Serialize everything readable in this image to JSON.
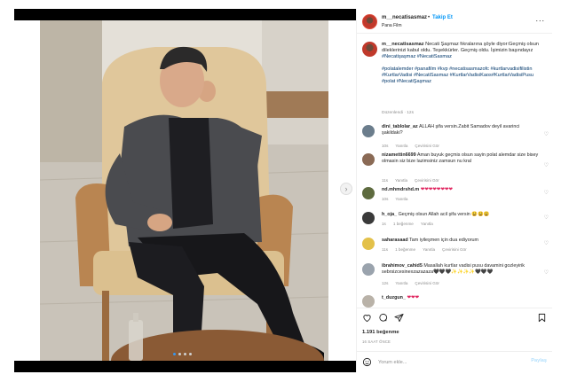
{
  "header": {
    "username": "m__necatisasmaz",
    "separator": "•",
    "follow_label": "Takip Et",
    "subtitle": "Pana Film",
    "more_label": "..."
  },
  "caption": {
    "username": "m__necatisasmaz",
    "text": "Necati Şaşmaz fıkralarına şöyle diyor:Geçmiş olsun dileklerinizi kabul oldu. Teşekkürler. Geçmiş oldu. İşimizin başındayız",
    "hashtags_1": "#Necatişaşmaz #NecatiSasmaz",
    "hashtags_2": "#polatalemder #panafilm #kvp #necatisasmazofc #kurtlarvadisifilistin #KurtlarVadisi #NecatiSasmaz #KurtlarVadisiKaos#KurtlarVadisiPusu #polat #NecatiŞaşmaz",
    "meta": "Düzenlendi · 12s"
  },
  "comments": [
    {
      "username": "dini_tablolar_az",
      "text": "ALLAH şifa versin.Zabit Samadov deyil avarinci şakildaki?",
      "age": "10s",
      "likes": "",
      "reply": "Yanıtla",
      "translate": "Çevirisini Gör"
    },
    {
      "username": "nizamettin6699",
      "text": "Aman buyuk geçmis olsun sayin polat alemdar size bisey olmasin siz bize lazimsiniz zamsun nu kral",
      "age": "11s",
      "likes": "",
      "reply": "Yanıtla",
      "translate": "Çevirisini Gör"
    },
    {
      "username": "nd.mhmdrshd.m",
      "text": "❤❤❤❤❤❤❤❤",
      "age": "10s",
      "likes": "",
      "reply": "Yanıtla",
      "translate": ""
    },
    {
      "username": "h_oja_",
      "text": "Geçmiş olsun Allah acil şifa versin 😩😩😩",
      "age": "1s",
      "likes": "1 beğenme",
      "reply": "Yanıtla",
      "translate": ""
    },
    {
      "username": "saharasaad",
      "text": "Tam iyileşmen için dua ediyorum",
      "age": "11s",
      "likes": "1 beğenme",
      "reply": "Yanıtla",
      "translate": "Çevirisini Gör"
    },
    {
      "username": "ibrahimov_cahid5",
      "text": "Masallah kurtlar vadisi pusu davamini gozleyirik sebrsizcesinexzazazaza🖤🖤🖤✨✨✨✨🖤🖤🖤",
      "age": "12s",
      "likes": "",
      "reply": "Yanıtla",
      "translate": "Çevirisini Gör"
    },
    {
      "username": "t_duzgun_",
      "text": "❤❤❤",
      "age": "",
      "likes": "",
      "reply": "",
      "translate": ""
    }
  ],
  "footer": {
    "likes": "1.191 beğenme",
    "time": "16 SAAT ÖNCE",
    "comment_placeholder": "Yorum ekle...",
    "post_label": "Paylaş"
  },
  "icons": {
    "next": "chevron-right-icon",
    "like": "heart-icon",
    "comment": "comment-icon",
    "share": "share-icon",
    "save": "bookmark-icon",
    "emoji": "emoji-icon"
  },
  "colors": {
    "follow": "#0095f6",
    "hashtag": "#00376b",
    "muted": "#8e8e8e",
    "heart_red": "#e0245e",
    "post_disabled": "#b2dffc"
  }
}
